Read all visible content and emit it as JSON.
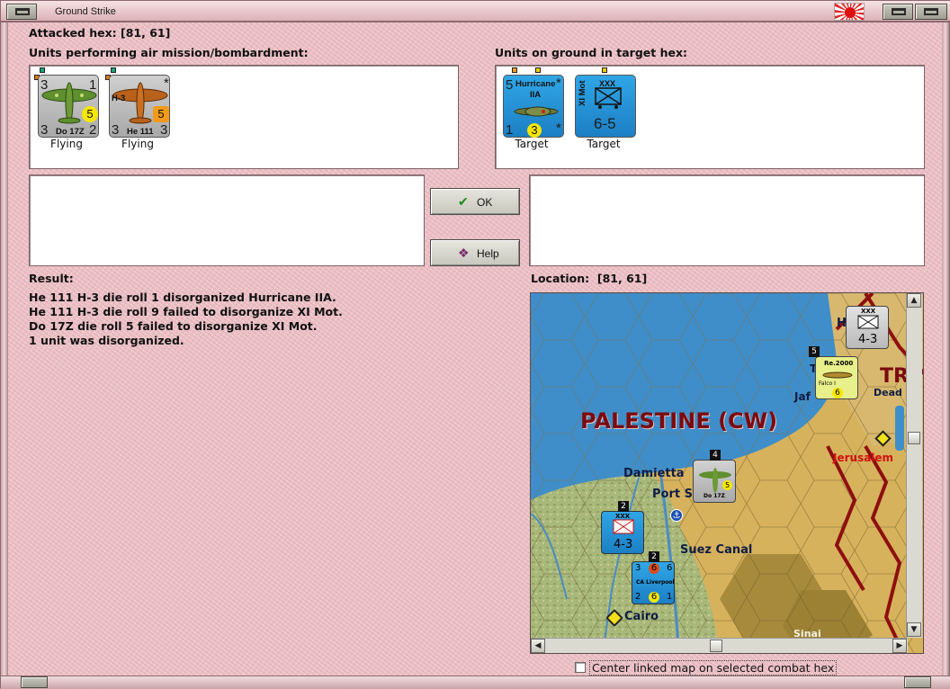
{
  "window": {
    "title": "Ground Strike"
  },
  "attacked_hex": {
    "label": "Attacked hex:",
    "value": "[81, 61]"
  },
  "air_units": {
    "heading": "Units performing air mission/bombardment:",
    "units": [
      {
        "name": "Do 17Z",
        "left_top": "3",
        "right_top": "1",
        "left_bottom": "3",
        "right_bottom": "2",
        "coin": "5",
        "coin_color": "#f6e600",
        "plane_color": "#5f8f2e",
        "status": "Flying"
      },
      {
        "name": "He 111",
        "subname": "H-3",
        "left_top": "",
        "right_top": "*",
        "left_bottom": "3",
        "right_bottom": "3",
        "coin": "5",
        "coin_color": "#f29a1a",
        "plane_color": "#b8611b",
        "status": "Flying"
      }
    ]
  },
  "ground_units": {
    "heading": "Units on ground in target hex:",
    "units": [
      {
        "name": "Hurricane",
        "subname": "IIA",
        "left_top": "5",
        "right_top": "*",
        "left_bottom": "1",
        "right_bottom": "*",
        "coin": "3",
        "status": "Target"
      },
      {
        "name": "XI Mot",
        "size": "XXX",
        "strength": "6-5",
        "status": "Target"
      }
    ]
  },
  "buttons": {
    "ok": "OK",
    "help": "Help"
  },
  "result": {
    "heading": "Result:",
    "lines": [
      "He 111 H-3 die roll 1 disorganized Hurricane IIA.",
      "He 111 H-3 die roll 9 failed to disorganize XI Mot.",
      "Do 17Z die roll 5 failed to disorganize XI Mot.",
      "1 unit was disorganized."
    ]
  },
  "location": {
    "label": "Location:",
    "value": "[81, 61]"
  },
  "map": {
    "region_label": "PALESTINE (CW)",
    "places": [
      "Damietta",
      "Port S",
      "Suez Canal",
      "Cairo",
      "Jerusalem",
      "Jaf",
      "Dead S",
      "Sinai",
      "H",
      "T",
      "TR"
    ],
    "counters": [
      {
        "id": "corps-north",
        "size": "XXX",
        "strength": "4-3"
      },
      {
        "id": "italian-air",
        "name": "Re.2000",
        "sub": "Falco I",
        "value": "6"
      },
      {
        "id": "do17-map",
        "name": "Do 17Z",
        "value": "5",
        "stack": "4"
      },
      {
        "id": "aus-corps",
        "size": "XXX",
        "strength": "4-3",
        "stack": "2"
      },
      {
        "id": "liverpool",
        "name": "CA Liverpool",
        "value": "6",
        "stack": "2",
        "top_left": "3",
        "top_mid": "6",
        "top_right": "6",
        "bottom_left": "2",
        "bottom_right": "1"
      }
    ]
  },
  "checkbox": {
    "label": "Center linked map on selected combat hex",
    "checked": false
  },
  "colors": {
    "background": "#ecc2c7",
    "sea": "#3f8ec9",
    "desert": "#d7b25c",
    "border_red": "#8e0f0f"
  }
}
